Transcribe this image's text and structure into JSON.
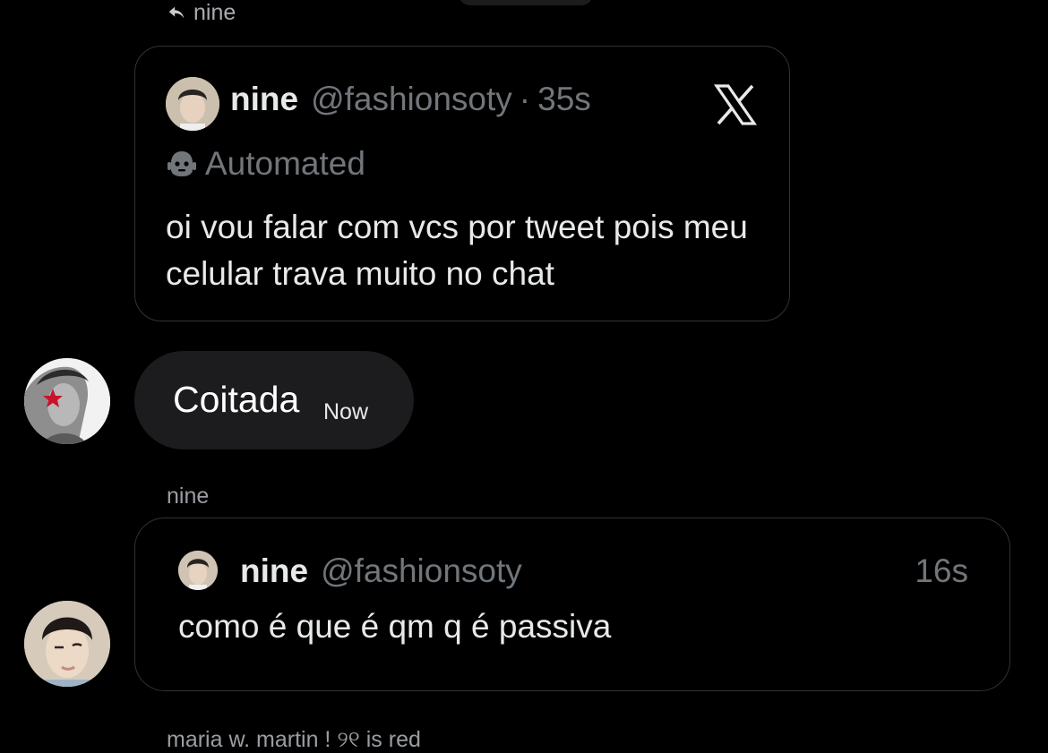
{
  "reply": {
    "label": "nine"
  },
  "quote_card": {
    "name": "nine",
    "handle": "@fashionsoty",
    "separator": "·",
    "time": "35s",
    "automated_label": "Automated",
    "text": "oi vou falar com vcs por tweet pois meu celular trava muito no chat"
  },
  "message": {
    "text": "Coitada",
    "time": "Now"
  },
  "sender_label": "nine",
  "tweet_card": {
    "name": "nine",
    "handle": "@fashionsoty",
    "time": "16s",
    "text": "como é que é qm q é passiva"
  },
  "footer_label": "maria w. martin ! ୨୧ is red",
  "colors": {
    "background": "#000000",
    "bubble": "#1c1c1e",
    "border": "#2f3336",
    "muted_text": "#71767b",
    "primary_text": "#e7e9ea"
  },
  "icons": [
    "reply-arrow-icon",
    "x-logo-icon",
    "robot-icon"
  ]
}
